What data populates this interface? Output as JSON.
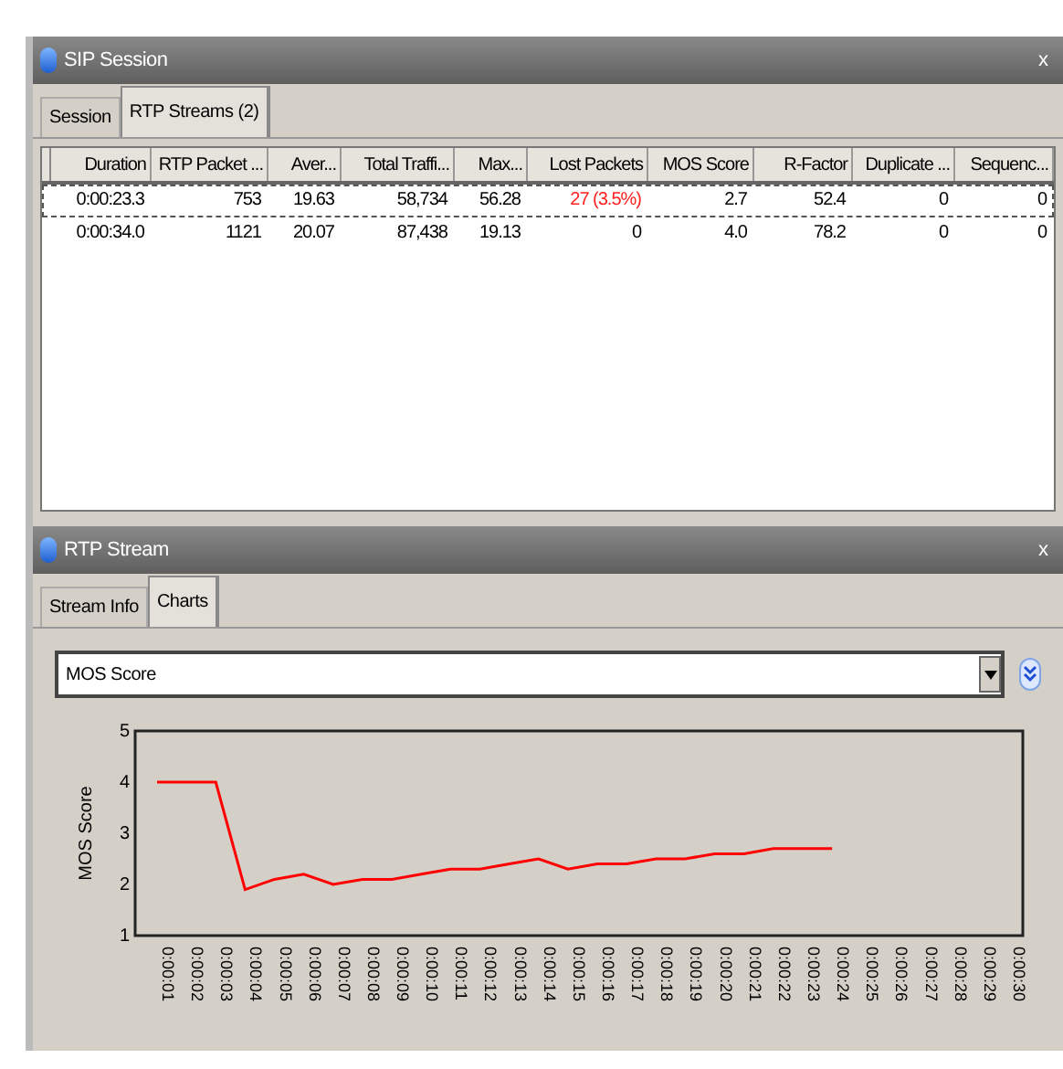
{
  "session_window": {
    "title": "SIP Session",
    "close": "x"
  },
  "session_tabs": [
    {
      "label": "Session",
      "selected": false
    },
    {
      "label": "RTP Streams (2)",
      "selected": true
    }
  ],
  "streams_table": {
    "columns": [
      "Duration",
      "RTP Packet ...",
      "Aver...",
      "Total Traffi...",
      "Max...",
      "Lost Packets",
      "MOS Score",
      "R-Factor",
      "Duplicate ...",
      "Sequenc..."
    ],
    "rows": [
      {
        "selected": true,
        "lost_alert": true,
        "cells": [
          "0:00:23.3",
          "753",
          "19.63",
          "58,734",
          "56.28",
          "27 (3.5%)",
          "2.7",
          "52.4",
          "0",
          "0"
        ]
      },
      {
        "selected": false,
        "lost_alert": false,
        "cells": [
          "0:00:34.0",
          "1121",
          "20.07",
          "87,438",
          "19.13",
          "0",
          "4.0",
          "78.2",
          "0",
          "0"
        ]
      }
    ]
  },
  "stream_window": {
    "title": "RTP Stream",
    "close": "x"
  },
  "stream_tabs": [
    {
      "label": "Stream Info",
      "selected": false
    },
    {
      "label": "Charts",
      "selected": true
    }
  ],
  "chart_select": {
    "value": "MOS Score"
  },
  "chart": {
    "chart_data": {
      "type": "line",
      "ylabel": "MOS Score",
      "categories": [
        "0:00:01",
        "0:00:02",
        "0:00:03",
        "0:00:04",
        "0:00:05",
        "0:00:06",
        "0:00:07",
        "0:00:08",
        "0:00:09",
        "0:00:10",
        "0:00:11",
        "0:00:12",
        "0:00:13",
        "0:00:14",
        "0:00:15",
        "0:00:16",
        "0:00:17",
        "0:00:18",
        "0:00:19",
        "0:00:20",
        "0:00:21",
        "0:00:22",
        "0:00:23",
        "0:00:24",
        "0:00:25",
        "0:00:26",
        "0:00:27",
        "0:00:28",
        "0:00:29",
        "0:00:30"
      ],
      "series": [
        {
          "color": "#ff0000",
          "values": [
            4.0,
            4.0,
            4.0,
            1.9,
            2.1,
            2.2,
            2.0,
            2.1,
            2.1,
            2.2,
            2.3,
            2.3,
            2.4,
            2.5,
            2.3,
            2.4,
            2.4,
            2.5,
            2.5,
            2.6,
            2.6,
            2.7,
            2.7,
            2.7,
            null,
            null,
            null,
            null,
            null,
            null
          ]
        }
      ],
      "ylim": [
        1,
        5
      ],
      "yticks": [
        1,
        2,
        3,
        4,
        5
      ]
    }
  }
}
